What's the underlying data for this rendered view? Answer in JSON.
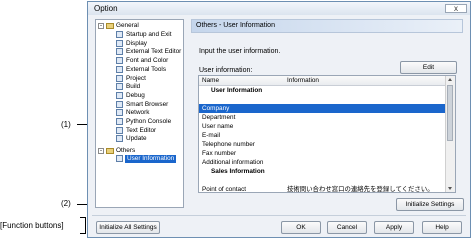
{
  "dialog": {
    "title": "Option",
    "close_glyph": "x"
  },
  "tree": {
    "general_label": "General",
    "general_toggle": "-",
    "general_items": [
      "Startup and Exit",
      "Display",
      "External Text Editor",
      "Font and Color",
      "External Tools",
      "Project",
      "Build",
      "Debug",
      "Smart Browser",
      "Network",
      "Python Console",
      "Text Editor",
      "Update"
    ],
    "others_label": "Others",
    "others_toggle": "-",
    "others_items": [
      "User Information"
    ]
  },
  "panel": {
    "header": "Others - User Information",
    "intro": "Input the user information.",
    "edit_button": "Edit",
    "user_info_label": "User information:",
    "initialize_settings": "Initialize Settings"
  },
  "grid": {
    "col_name": "Name",
    "col_info": "Information",
    "rows": [
      {
        "name": "User Information",
        "info": "",
        "kind": "group"
      },
      {
        "name": "",
        "info": "",
        "kind": "blank"
      },
      {
        "name": "Company",
        "info": "",
        "kind": "selected"
      },
      {
        "name": "Department",
        "info": "",
        "kind": "normal"
      },
      {
        "name": "User name",
        "info": "",
        "kind": "normal"
      },
      {
        "name": "E-mail",
        "info": "",
        "kind": "normal"
      },
      {
        "name": "Telephone number",
        "info": "",
        "kind": "normal"
      },
      {
        "name": "Fax number",
        "info": "",
        "kind": "normal"
      },
      {
        "name": "Additional information",
        "info": "",
        "kind": "normal"
      },
      {
        "name": "Sales Information",
        "info": "",
        "kind": "group"
      },
      {
        "name": "",
        "info": "",
        "kind": "blank"
      },
      {
        "name": "Point of contact",
        "info": "技術問い合わせ窓口の連絡先を登録してください。",
        "kind": "normal"
      }
    ]
  },
  "footer": {
    "initialize_all": "Initialize All Settings",
    "ok": "OK",
    "cancel": "Cancel",
    "apply": "Apply",
    "help": "Help"
  },
  "annotations": {
    "a1": "(1)",
    "a2": "(2)",
    "function_buttons": "[Function buttons]"
  },
  "colors": {
    "selection": "#1a66cc",
    "accent": "#6d8fb2"
  }
}
